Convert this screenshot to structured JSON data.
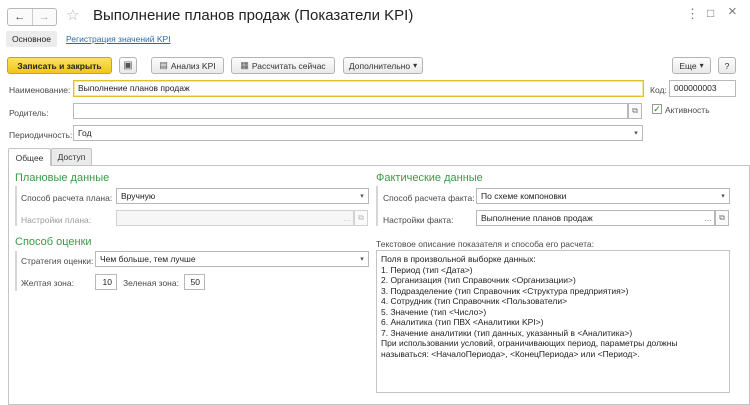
{
  "window": {
    "title": "Выполнение планов продаж (Показатели KPI)",
    "back_glyph": "←",
    "forward_glyph": "→",
    "star_glyph": "☆",
    "menu_glyph": "⋮",
    "maximize_glyph": "□",
    "close_glyph": "×"
  },
  "sections": {
    "active": "Основное",
    "link": "Регистрация значений KPI"
  },
  "toolbar": {
    "save_close": "Записать и закрыть",
    "save_glyph": "▣",
    "analysis": "Анализ KPI",
    "analysis_glyph": "▤",
    "calculate": "Рассчитать сейчас",
    "calculate_glyph": "▦",
    "more": "Дополнительно",
    "etc": "Еще",
    "help": "?",
    "dropdown_glyph": "▾"
  },
  "form": {
    "name_label": "Наименование:",
    "name_value": "Выполнение планов продаж",
    "code_label": "Код:",
    "code_value": "000000003",
    "active_label": "Активность",
    "active_checked": true,
    "check_glyph": "✓",
    "parent_label": "Родитель:",
    "parent_value": "",
    "period_label": "Периодичность:",
    "period_value": "Год",
    "pick_glyph": "...",
    "open_glyph": "⧉"
  },
  "tabs": [
    {
      "label": "Общее",
      "active": true
    },
    {
      "label": "Доступ",
      "active": false
    }
  ],
  "plan": {
    "title": "Плановые данные",
    "method_label": "Способ расчета плана:",
    "method_value": "Вручную",
    "settings_label": "Настройки плана:",
    "settings_value": ""
  },
  "fact": {
    "title": "Фактические данные",
    "method_label": "Способ расчета факта:",
    "method_value": "По схеме компоновки",
    "settings_label": "Настройки факта:",
    "settings_value": "Выполнение планов продаж"
  },
  "evaluation": {
    "title": "Способ оценки",
    "strategy_label": "Стратегия оценки:",
    "strategy_value": "Чем больше, тем лучше",
    "yellow_label": "Желтая зона:",
    "yellow_value": "10",
    "green_label": "Зеленая зона:",
    "green_value": "50"
  },
  "description": {
    "label": "Текстовое описание показателя и способа его расчета:",
    "lines": [
      "Поля в произвольной выборке данных:",
      "1. Период (тип <Дата>)",
      "2. Организация (тип Справочник <Организации>)",
      "3. Подразделение (тип Справочник <Структура предприятия>)",
      "4. Сотрудник (тип Справочник <Пользователи>",
      "5. Значение (тип <Число>)",
      "6. Аналитика (тип ПВХ <Аналитики KPI>)",
      "7. Значение аналитики (тип данных, указанный в <Аналитика>)",
      "При использовании условий, ограничивающих период, параметры должны",
      "называться: <НачалоПериода>, <КонецПериода> или <Период>."
    ]
  }
}
